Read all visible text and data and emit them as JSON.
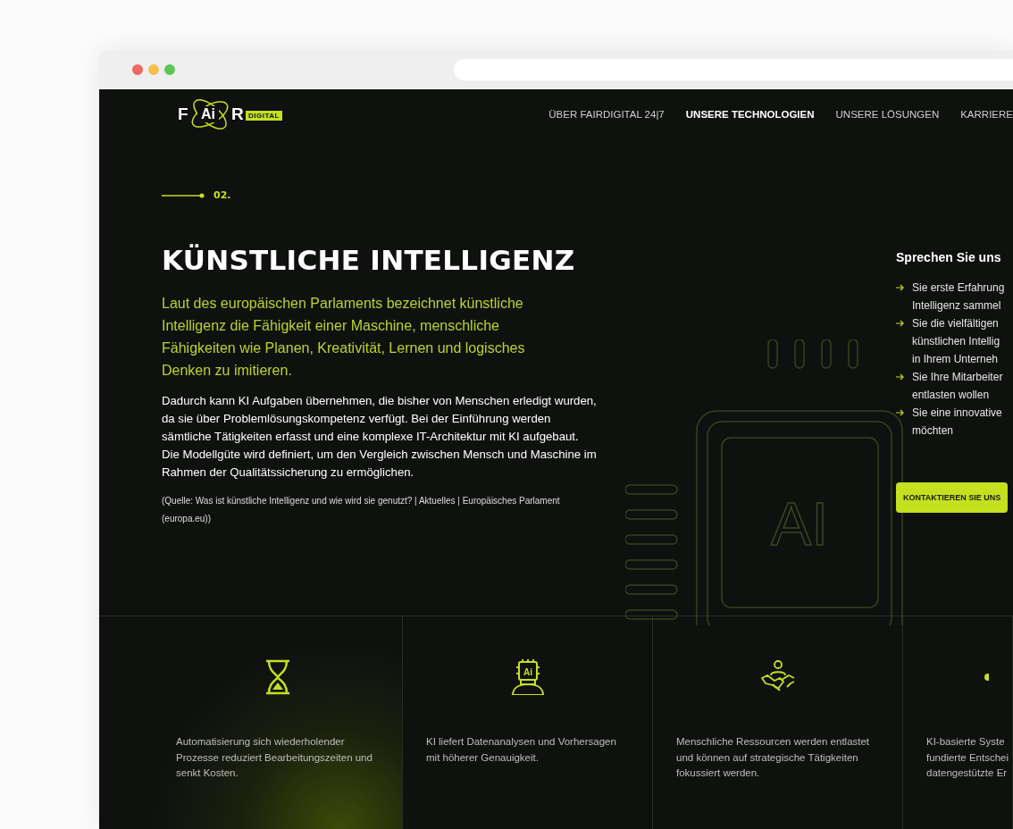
{
  "logo": {
    "letters": [
      "F",
      "Ai",
      "R"
    ],
    "tag": "DIGITAL"
  },
  "nav": [
    {
      "label": "ÜBER FAIRDIGITAL 24|7",
      "selected": false
    },
    {
      "label": "UNSERE TECHNOLOGIEN",
      "selected": true
    },
    {
      "label": "UNSERE LÖSUNGEN",
      "selected": false
    },
    {
      "label": "KARRIERE",
      "selected": false
    }
  ],
  "section_number": "02.",
  "title": "KÜNSTLICHE INTELLIGENZ",
  "lead": "Laut des europäischen Parlaments bezeichnet künstliche Intelligenz die Fähigkeit einer Maschine, menschliche Fähigkeiten wie Planen, Kreativität, Lernen und logisches Denken zu imitieren.",
  "body": "Dadurch kann KI Aufgaben übernehmen, die bisher von Menschen erledigt wurden, da sie über Problemlösungskompetenz verfügt. Bei der Einführung werden sämtliche Tätigkeiten erfasst und eine komplexe IT-Architektur mit KI aufgebaut. Die Modellgüte wird definiert, um den Vergleich zwischen Mensch und Maschine im Rahmen der Qualitätssicherung zu ermöglichen.",
  "source": "(Quelle: Was ist künstliche Intelligenz und wie wird sie genutzt? | Aktuelles | Europäisches Parlament (europa.eu))",
  "chip_label": "AI",
  "contact": {
    "heading": "Sprechen Sie uns",
    "items": [
      {
        "lines": [
          "Sie erste Erfahrung",
          "Intelligenz sammel"
        ]
      },
      {
        "lines": [
          "Sie die vielfältigen",
          "künstlichen Intellig",
          "in Ihrem Unterneh"
        ]
      },
      {
        "lines": [
          "Sie Ihre Mitarbeiter",
          "entlasten wollen"
        ]
      },
      {
        "lines": [
          "Sie eine innovative",
          "möchten"
        ]
      }
    ],
    "button": "KONTAKTIEREN SIE UNS"
  },
  "cards": [
    {
      "kind": "hourglass",
      "lines": [
        "Automatisierung sich wiederholender",
        "Prozesse reduziert Bearbeitungszeiten und",
        "senkt Kosten."
      ]
    },
    {
      "kind": "ai-head",
      "icon_label": "Ai",
      "lines": [
        "KI liefert Datenanalysen und Vorhersagen",
        "mit höherer Genauigkeit."
      ]
    },
    {
      "kind": "handshake",
      "lines": [
        "Menschliche Ressourcen werden entlastet",
        "und können auf strategische Tätigkeiten",
        "fokussiert werden."
      ]
    },
    {
      "kind": "partial",
      "lines": [
        "KI-basierte Syste",
        "fundierte Entschei",
        "datengestützte Er"
      ]
    }
  ]
}
